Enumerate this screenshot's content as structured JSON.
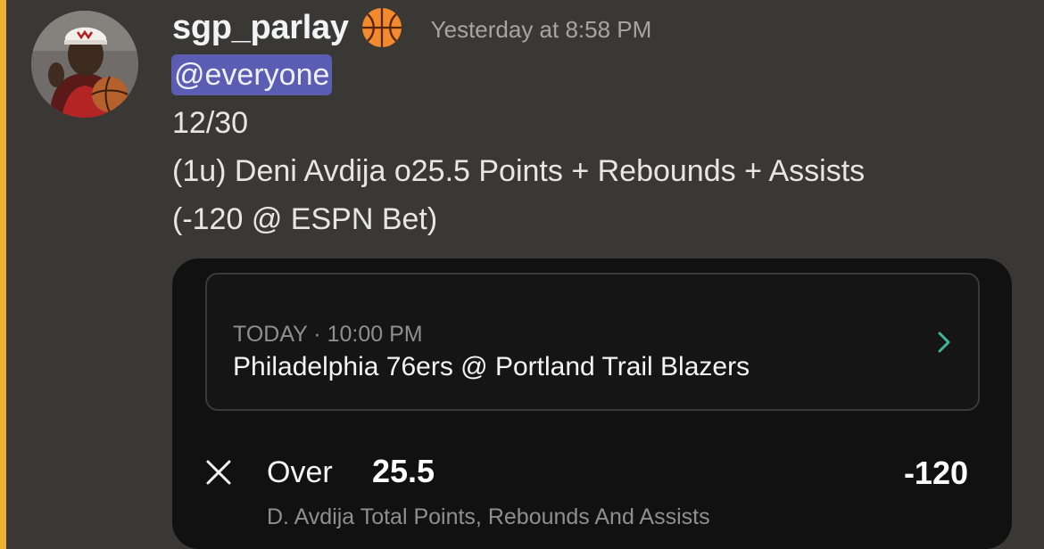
{
  "colors": {
    "background": "#3a3835",
    "mention_bar": "#f0b232",
    "mention_bg": "#5a5db2",
    "card_bg": "#111111",
    "chevron": "#3fb5a0"
  },
  "message": {
    "username": "sgp_parlay",
    "emoji": "basketball",
    "timestamp": "Yesterday at 8:58 PM",
    "mention": "@everyone",
    "lines": [
      "12/30",
      "(1u) Deni Avdija o25.5 Points + Rebounds + Assists",
      "(-120 @ ESPN Bet)"
    ]
  },
  "bet_card": {
    "game_time": "TODAY · 10:00 PM",
    "matchup": "Philadelphia 76ers @ Portland Trail Blazers",
    "side": "Over",
    "line": "25.5",
    "odds": "-120",
    "market": "D. Avdija Total Points, Rebounds And Assists",
    "icons": {
      "remove": "close-icon",
      "open_game": "chevron-right-icon"
    }
  }
}
